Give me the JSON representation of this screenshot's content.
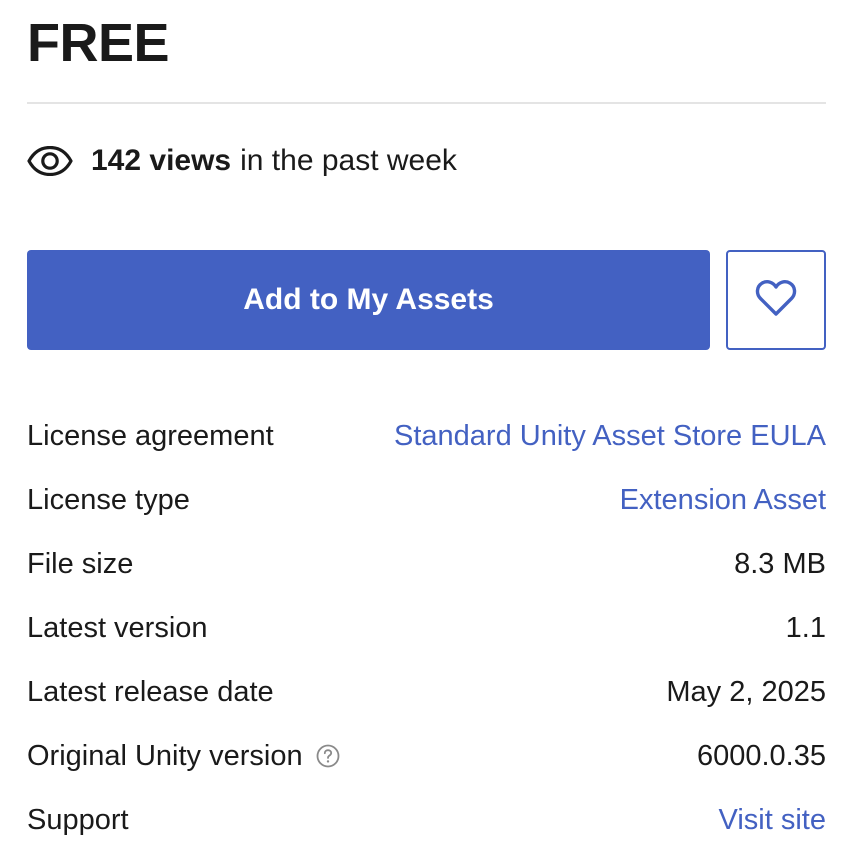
{
  "price": "FREE",
  "views": {
    "icon": "eye-icon",
    "count": "142 views",
    "suffix": "in the past week"
  },
  "actions": {
    "add_label": "Add to My Assets",
    "favorite_icon": "heart-icon",
    "accent_color": "#4361c2"
  },
  "details": [
    {
      "label": "License agreement",
      "value": "Standard Unity Asset Store EULA",
      "link": true
    },
    {
      "label": "License type",
      "value": "Extension Asset",
      "link": true
    },
    {
      "label": "File size",
      "value": "8.3 MB",
      "link": false
    },
    {
      "label": "Latest version",
      "value": "1.1",
      "link": false
    },
    {
      "label": "Latest release date",
      "value": "May 2, 2025",
      "link": false
    },
    {
      "label": "Original Unity version",
      "value": "6000.0.35",
      "link": false,
      "help_icon": "question-circle-icon"
    },
    {
      "label": "Support",
      "value": "Visit site",
      "link": true
    }
  ]
}
